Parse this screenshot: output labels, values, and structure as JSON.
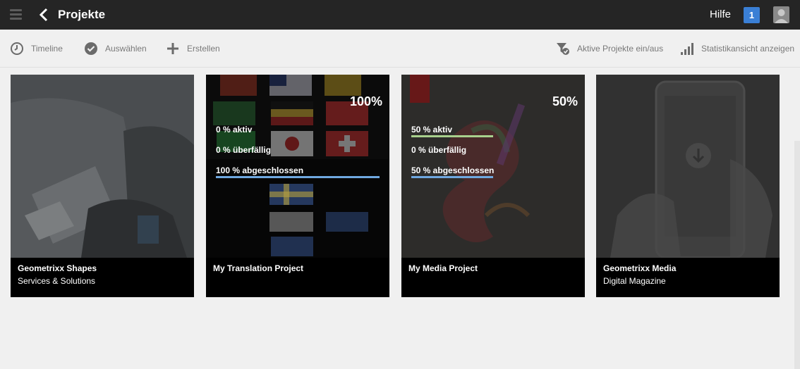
{
  "header": {
    "title": "Projekte",
    "help_label": "Hilfe",
    "notification_count": "1"
  },
  "toolbar": {
    "timeline": "Timeline",
    "select": "Auswählen",
    "create": "Erstellen",
    "filter": "Aktive Projekte ein/aus",
    "stats": "Statistikansicht anzeigen"
  },
  "cards": [
    {
      "title": "Geometrixx Shapes",
      "subtitle": "Services & Solutions"
    },
    {
      "title": "My Translation Project",
      "percent": "100%",
      "progress": 1.0,
      "stats": [
        "0 % aktiv",
        "0 % überfällig",
        "100 % abgeschlossen"
      ]
    },
    {
      "title": "My Media Project",
      "percent": "50%",
      "progress": 0.5,
      "stats": [
        "50 % aktiv",
        "0 % überfällig",
        "50 % abgeschlossen"
      ]
    },
    {
      "title": "Geometrixx Media",
      "subtitle": "Digital Magazine"
    }
  ],
  "colors": {
    "topbar": "#252525",
    "accent_blue": "#3a7fd5",
    "active_bar": "#a8d08d",
    "complete_bar": "#6fa8e0"
  },
  "icons": [
    "menu-icon",
    "back-chevron-icon",
    "user-avatar-icon",
    "clock-icon",
    "check-circle-icon",
    "plus-icon",
    "filter-check-icon",
    "bar-stats-icon"
  ]
}
